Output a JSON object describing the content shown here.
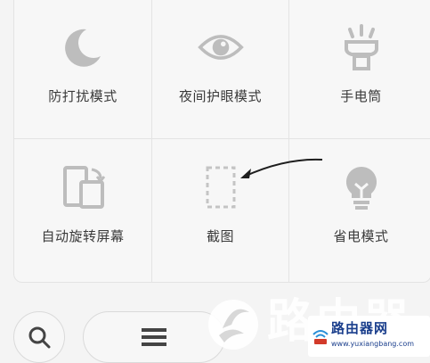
{
  "tiles": [
    {
      "label": "防打扰模式",
      "icon": "moon-icon"
    },
    {
      "label": "夜间护眼模式",
      "icon": "eye-icon"
    },
    {
      "label": "手电筒",
      "icon": "flashlight-icon"
    },
    {
      "label": "自动旋转屏幕",
      "icon": "auto-rotate-icon"
    },
    {
      "label": "截图",
      "icon": "screenshot-icon"
    },
    {
      "label": "省电模式",
      "icon": "lightbulb-icon"
    }
  ],
  "bottom_bar": {
    "search_icon": "search-icon",
    "menu_icon": "menu-icon"
  },
  "watermark": {
    "text": "路由器",
    "badge_title": "路由器网",
    "badge_url": "www.yuxiangbang.com"
  },
  "colors": {
    "icon": "#b9b9b9",
    "label": "#3a3a3a",
    "panel_bg": "#f7f7f7"
  }
}
